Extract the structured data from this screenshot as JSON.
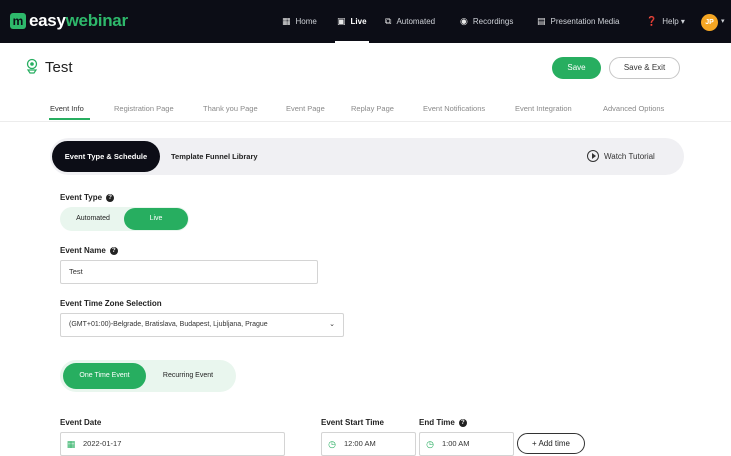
{
  "brand": {
    "logo_mark": "m",
    "logo_name_a": "easy",
    "logo_name_b": "webinar",
    "accent_color": "#27ae60"
  },
  "nav": {
    "items": [
      {
        "label": "Home",
        "icon": "grid-icon"
      },
      {
        "label": "Live",
        "icon": "monitor-icon",
        "active": true
      },
      {
        "label": "Automated",
        "icon": "automated-icon"
      },
      {
        "label": "Recordings",
        "icon": "record-icon"
      },
      {
        "label": "Presentation Media",
        "icon": "document-icon"
      },
      {
        "label": "Help",
        "icon": "help-icon"
      }
    ],
    "help_caret": "▾",
    "avatar_initials": "JP"
  },
  "header": {
    "title": "Test",
    "save_label": "Save",
    "save_exit_label": "Save & Exit"
  },
  "tabs": [
    "Event Info",
    "Registration Page",
    "Thank you Page",
    "Event Page",
    "Replay Page",
    "Event Notifications",
    "Event Integration",
    "Advanced Options"
  ],
  "card": {
    "active_pill": "Event Type & Schedule",
    "secondary_link": "Template Funnel Library",
    "tutorial_label": "Watch Tutorial"
  },
  "form": {
    "event_type_label": "Event Type",
    "event_type_options": [
      "Automated",
      "Live"
    ],
    "event_type_selected": "Live",
    "event_name_label": "Event Name",
    "event_name_value": "Test",
    "timezone_label": "Event Time Zone Selection",
    "timezone_value": "(GMT+01:00)-Belgrade, Bratislava, Budapest, Ljubljana, Prague",
    "frequency_options": [
      "One Time Event",
      "Recurring Event"
    ],
    "frequency_selected": "One Time Event",
    "event_date_label": "Event Date",
    "event_date_value": "2022-01-17",
    "start_time_label": "Event Start Time",
    "start_time_value": "12:00 AM",
    "end_time_label": "End Time",
    "end_time_value": "1:00 AM",
    "add_time_label": "+ Add time"
  }
}
